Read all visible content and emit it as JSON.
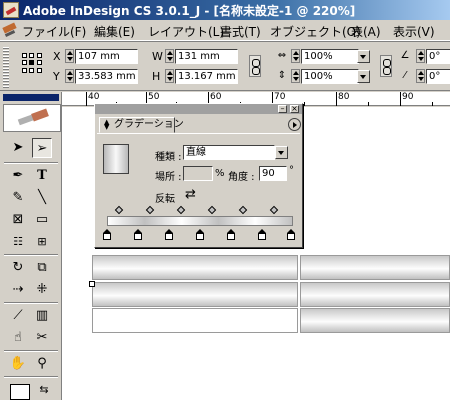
{
  "window": {
    "title": "Adobe InDesign CS 3.0.1_J - [名称未設定-1 @ 220%]"
  },
  "menubar": {
    "items": [
      "ファイル(F)",
      "編集(E)",
      "レイアウト(L)",
      "書式(T)",
      "オブジェクト(O)",
      "表(A)",
      "表示(V)"
    ]
  },
  "control": {
    "x_label": "X",
    "x_value": "107 mm",
    "y_label": "Y",
    "y_value": "33.583 mm",
    "w_label": "W",
    "w_value": "131 mm",
    "h_label": "H",
    "h_value": "13.167 mm",
    "scale_x": "100%",
    "scale_y": "100%",
    "angle": "0°",
    "shear": "0°"
  },
  "ruler": {
    "labels": [
      "40",
      "50",
      "60",
      "70",
      "80",
      "90"
    ]
  },
  "gradient_panel": {
    "tab": "グラデーション",
    "type_label": "種類 :",
    "type_value": "直線",
    "location_label": "場所 :",
    "location_value": "",
    "percent": "%",
    "angle_label": "角度 :",
    "angle_value": "90",
    "degree": "°",
    "reverse_label": "反転",
    "stops_count": 7,
    "midpoints_count": 6
  },
  "colors": {
    "titlebar": "#0a246a",
    "chrome": "#d4d0c8"
  },
  "icons": [
    "selection-tool-icon",
    "direct-selection-tool-icon",
    "pen-tool-icon",
    "type-tool-icon",
    "pencil-tool-icon",
    "line-tool-icon",
    "rectangle-frame-tool-icon",
    "rectangle-tool-icon",
    "rotate-tool-icon",
    "scale-tool-icon",
    "shear-tool-icon",
    "free-transform-tool-icon",
    "eyedropper-tool-icon",
    "gradient-tool-icon",
    "button-tool-icon",
    "scissors-tool-icon",
    "hand-tool-icon",
    "zoom-tool-icon"
  ]
}
